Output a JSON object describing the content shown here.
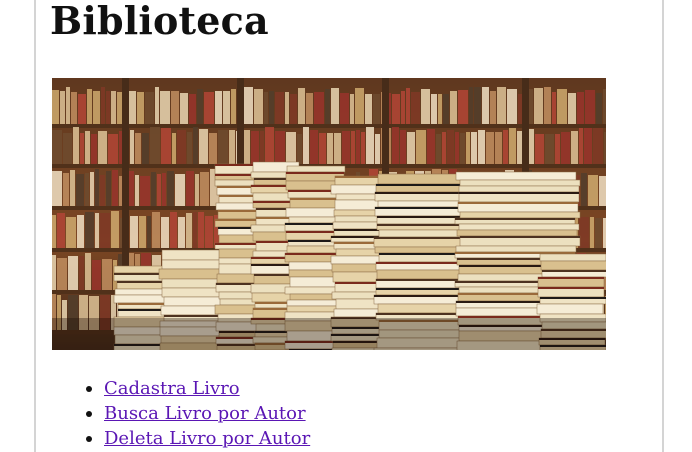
{
  "page": {
    "title": "Biblioteca"
  },
  "hero": {
    "alt": "Pilhas de livros em uma biblioteca"
  },
  "menu": {
    "items": [
      {
        "label": "Cadastra Livro"
      },
      {
        "label": "Busca Livro por Autor"
      },
      {
        "label": "Deleta Livro por Autor"
      }
    ]
  },
  "colors": {
    "link": "#5a16b4",
    "heading": "#111111",
    "border": "#d4d4d4"
  }
}
